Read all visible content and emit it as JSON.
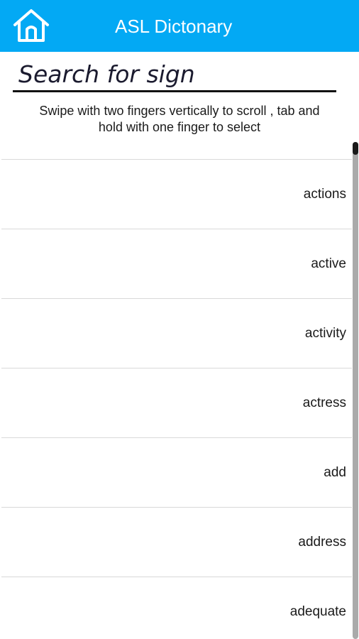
{
  "header": {
    "title": "ASL Dictonary",
    "home_icon": "home-icon",
    "background_color": "#03a9f4"
  },
  "search": {
    "placeholder": "Search for sign",
    "value": ""
  },
  "hint": {
    "line1": "Swipe with two fingers vertically to scroll , tab and",
    "line2": "hold with one finger to select"
  },
  "list": {
    "items": [
      {
        "label": "actions"
      },
      {
        "label": "active"
      },
      {
        "label": "activity"
      },
      {
        "label": "actress"
      },
      {
        "label": "add"
      },
      {
        "label": "address"
      },
      {
        "label": "adequate"
      }
    ]
  }
}
